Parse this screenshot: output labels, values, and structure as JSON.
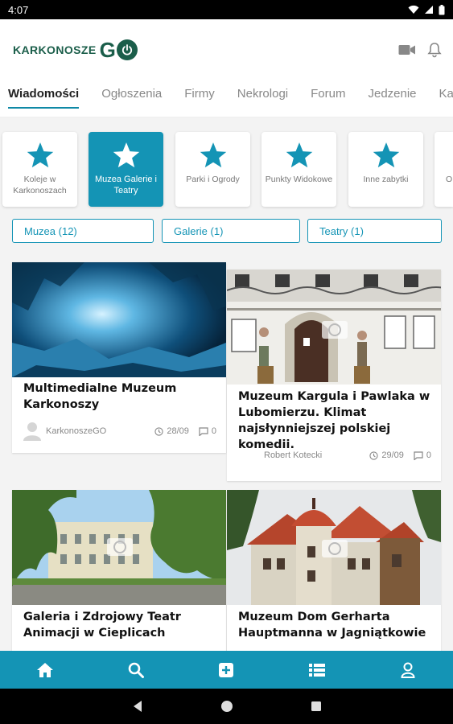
{
  "status": {
    "time": "4:07"
  },
  "header": {
    "logo_word": "KARKONOSZE",
    "logo_go": "G"
  },
  "tabs": [
    {
      "label": "Wiadomości"
    },
    {
      "label": "Ogłoszenia"
    },
    {
      "label": "Firmy"
    },
    {
      "label": "Nekrologi"
    },
    {
      "label": "Forum"
    },
    {
      "label": "Jedzenie"
    },
    {
      "label": "Ka"
    }
  ],
  "categories": [
    {
      "label": "Koleje w Karkonoszach"
    },
    {
      "label": "Muzea Galerie i Teatry"
    },
    {
      "label": "Parki i Ogrody"
    },
    {
      "label": "Punkty Widokowe"
    },
    {
      "label": "Inne zabytki"
    },
    {
      "label": "O"
    }
  ],
  "filters": [
    {
      "label": "Muzea (12)"
    },
    {
      "label": "Galerie (1)"
    },
    {
      "label": "Teatry (1)"
    }
  ],
  "articles": [
    {
      "title": "Multimedialne Muzeum Karkonoszy",
      "author": "KarkonoszeGO",
      "date": "28/09",
      "comments": "0"
    },
    {
      "title": "Muzeum Kargula i Pawlaka w Lubomierzu. Klimat najsłynniejszej polskiej komedii.",
      "author": "Robert Kotecki",
      "date": "29/09",
      "comments": "0"
    },
    {
      "title": "Galeria i Zdrojowy Teatr Animacji w Cieplicach"
    },
    {
      "title": "Muzeum Dom Gerharta Hauptmanna w Jagniątkowie"
    }
  ],
  "colors": {
    "accent": "#1494b5",
    "brand": "#1b5e4a"
  },
  "icons": {
    "bottom_nav": [
      "home-icon",
      "search-icon",
      "add-icon",
      "list-icon",
      "profile-icon"
    ]
  }
}
